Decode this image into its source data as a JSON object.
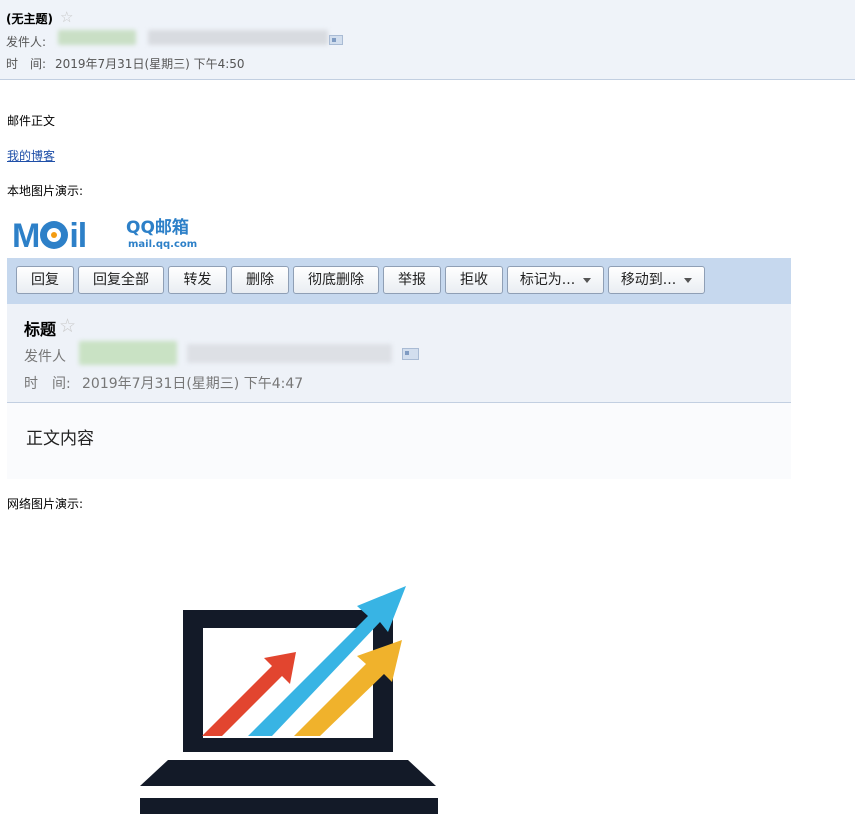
{
  "header": {
    "subject": "(无主题)",
    "sender_label": "发件人:",
    "time_label": "时　间:",
    "time_value": "2019年7月31日(星期三) 下午4:50"
  },
  "body": {
    "intro": "邮件正文",
    "blog_link": "我的博客",
    "local_image_label": "本地图片演示:",
    "web_image_label": "网络图片演示:"
  },
  "local_screenshot": {
    "logo": {
      "word_m": "M",
      "word_il": "il",
      "cn": "QQ邮箱",
      "domain": "mail.qq.com"
    },
    "toolbar": {
      "buttons": [
        "回复",
        "回复全部",
        "转发",
        "删除",
        "彻底删除",
        "举报",
        "拒收",
        "标记为...",
        "移动到..."
      ]
    },
    "subject": "标题",
    "sender_label": "发件人",
    "time_label": "时　间:",
    "time_value": "2019年7月31日(星期三) 下午4:47",
    "body_text": "正文内容"
  },
  "colors": {
    "header_bg": "#eff3f9",
    "toolbar_bg": "#c6d8ee",
    "logo_blue": "#2d80c8",
    "arrow_red": "#e2452f",
    "arrow_blue": "#38b4e4",
    "arrow_yellow": "#f0b22c",
    "laptop_dark": "#131a28"
  },
  "icons": [
    "star-icon",
    "contact-card-icon",
    "caret-down-icon",
    "trend-laptop-image"
  ]
}
